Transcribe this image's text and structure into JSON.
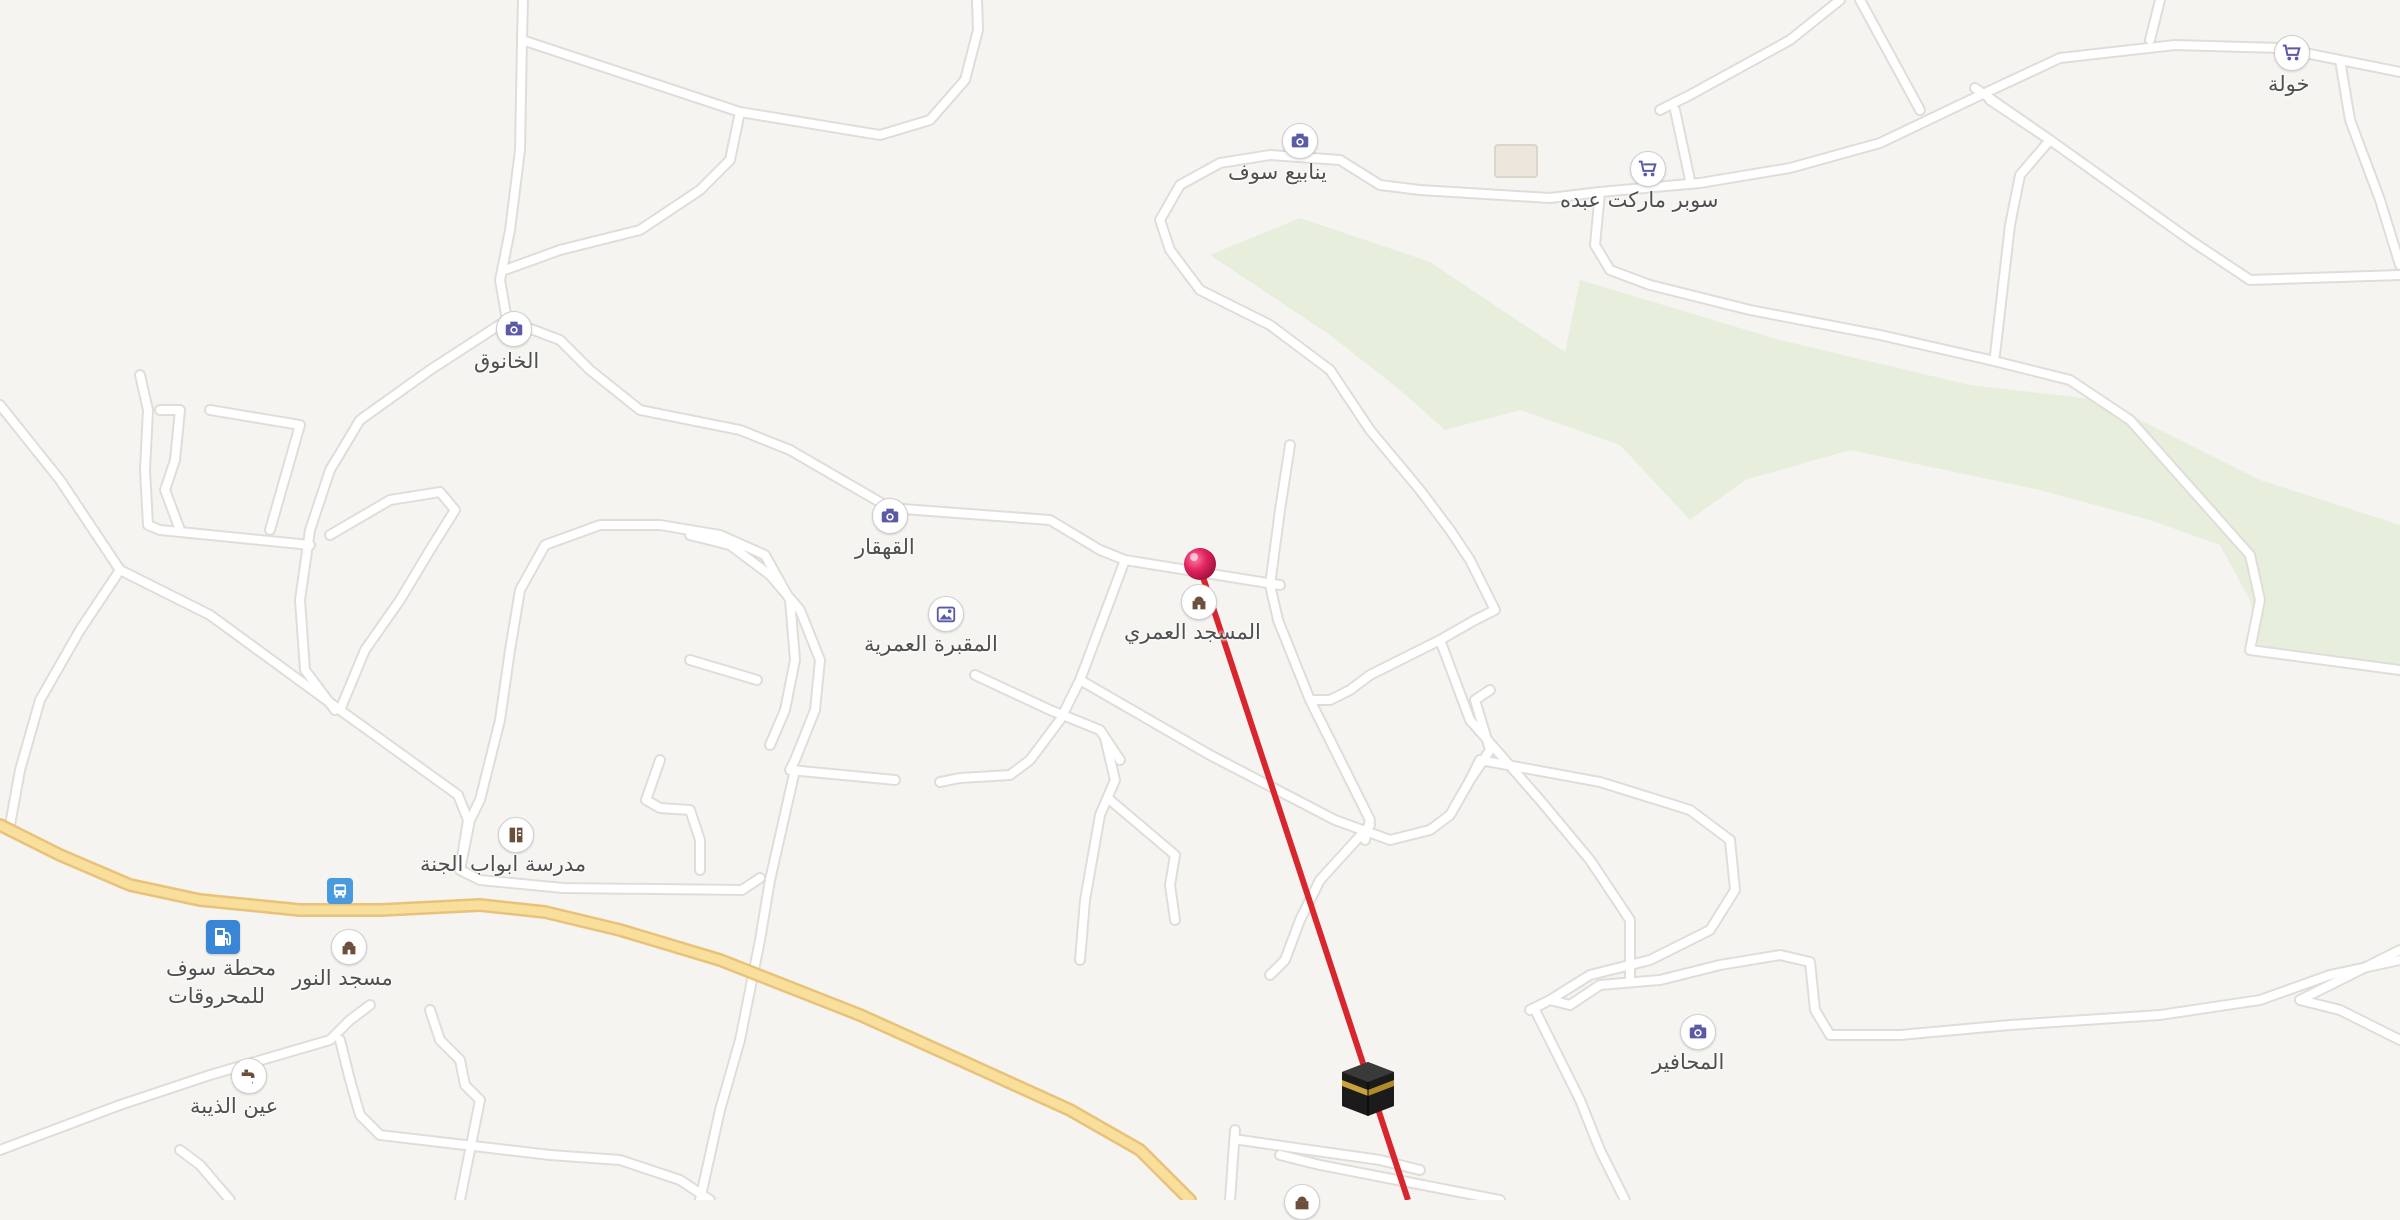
{
  "map": {
    "colors": {
      "background": "#f6f4f1",
      "road": "#ffffff",
      "road_casing": "#e2dfdb",
      "main_road": "#f9df9c",
      "main_road_casing": "#e9c27a",
      "green_area": "#e7eedc",
      "route_line": "#d8262f",
      "poi_icon": "#5a5aa8",
      "pin": "#e0245e"
    },
    "places": [
      {
        "id": "khawla",
        "name": "خولة",
        "icon": "shopping-cart-icon"
      },
      {
        "id": "yanabee-souf",
        "name": "ينابيع سوف",
        "icon": "camera-icon"
      },
      {
        "id": "supermarket-abdo",
        "name": "سوبر ماركت عبده",
        "icon": "shopping-cart-icon"
      },
      {
        "id": "al-khanouq",
        "name": "الخانوق",
        "icon": "camera-icon"
      },
      {
        "id": "al-qahqar",
        "name": "القهقار",
        "icon": "camera-icon"
      },
      {
        "id": "omari-cemetery",
        "name": "المقبرة العمرية",
        "icon": "cemetery-icon"
      },
      {
        "id": "omari-mosque",
        "name": "المسجد العمري",
        "icon": "mosque-icon"
      },
      {
        "id": "abwab-aljanna-school",
        "name": "مدرسة ابواب الجنة",
        "icon": "school-icon"
      },
      {
        "id": "souf-fuel-station",
        "name": "محطة سوف للمحروقات",
        "name_line1": "محطة سوف",
        "name_line2": "للمحروقات",
        "icon": "fuel-pump-icon"
      },
      {
        "id": "al-nour-mosque",
        "name": "مسجد النور",
        "icon": "mosque-icon"
      },
      {
        "id": "ain-al-dhaiba",
        "name": "عين الذيبة",
        "icon": "water-tap-icon"
      },
      {
        "id": "al-mahafir",
        "name": "المحافير",
        "icon": "camera-icon"
      }
    ],
    "markers": {
      "selected_pin": "map-pin-icon",
      "qibla_marker": "kaaba-icon",
      "bus_stop": "bus-icon"
    }
  }
}
